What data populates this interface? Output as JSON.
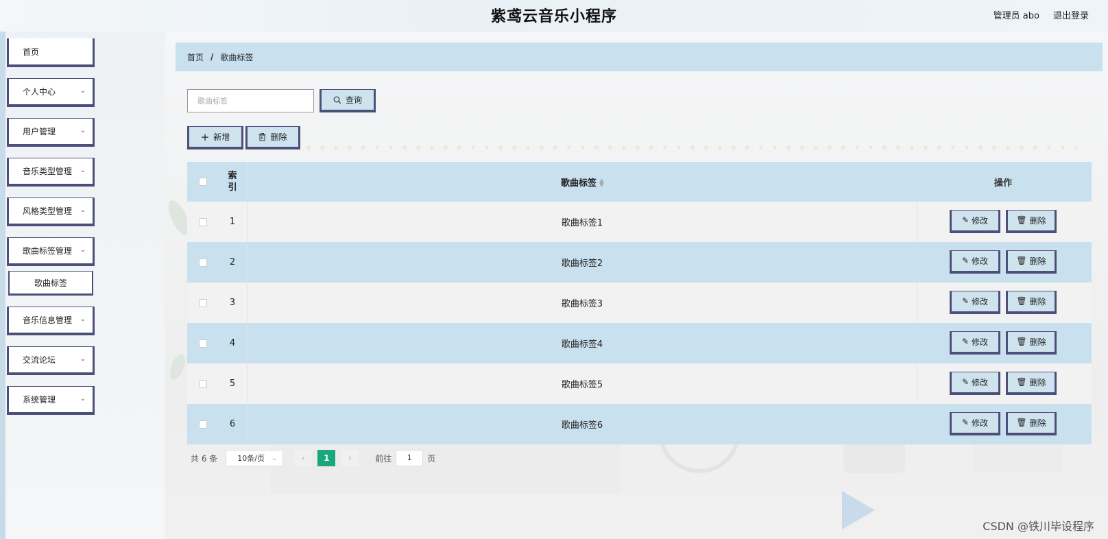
{
  "header": {
    "title": "紫鸢云音乐小程序",
    "user": "管理员 abo",
    "logout": "退出登录"
  },
  "sidebar": {
    "items": [
      {
        "label": "首页",
        "has_chevron": false
      },
      {
        "label": "个人中心",
        "has_chevron": true
      },
      {
        "label": "用户管理",
        "has_chevron": true
      },
      {
        "label": "音乐类型管理",
        "has_chevron": true
      },
      {
        "label": "风格类型管理",
        "has_chevron": true
      },
      {
        "label": "歌曲标签管理",
        "has_chevron": true,
        "expanded": true,
        "children": [
          {
            "label": "歌曲标签"
          }
        ]
      },
      {
        "label": "音乐信息管理",
        "has_chevron": true
      },
      {
        "label": "交流论坛",
        "has_chevron": true
      },
      {
        "label": "系统管理",
        "has_chevron": true
      }
    ]
  },
  "breadcrumb": {
    "home": "首页",
    "separator": "/",
    "current": "歌曲标签"
  },
  "search": {
    "placeholder": "歌曲标签",
    "value": "",
    "query_label": "查询",
    "query_icon": "search-icon"
  },
  "toolbar": {
    "add_label": "新增",
    "add_icon": "plus-icon",
    "delete_label": "删除",
    "delete_icon": "trash-icon"
  },
  "table": {
    "headers": {
      "index": "索引",
      "tag": "歌曲标签",
      "ops": "操作"
    },
    "rows": [
      {
        "index": "1",
        "tag": "歌曲标签1"
      },
      {
        "index": "2",
        "tag": "歌曲标签2"
      },
      {
        "index": "3",
        "tag": "歌曲标签3"
      },
      {
        "index": "4",
        "tag": "歌曲标签4"
      },
      {
        "index": "5",
        "tag": "歌曲标签5"
      },
      {
        "index": "6",
        "tag": "歌曲标签6"
      }
    ],
    "row_actions": {
      "edit_label": "修改",
      "edit_icon": "edit-icon",
      "delete_label": "删除",
      "delete_icon": "trash-icon"
    }
  },
  "pagination": {
    "total": "共 6 条",
    "page_size": "10条/页",
    "current_page": "1",
    "goto_prefix": "前往",
    "goto_value": "1",
    "goto_suffix": "页"
  },
  "watermark": {
    "csdn": "CSDN @铁川毕设程序"
  },
  "colors": {
    "accent": "#c9e0ee",
    "frame": "#4c4f7a",
    "pager_active": "#1aa77a"
  }
}
